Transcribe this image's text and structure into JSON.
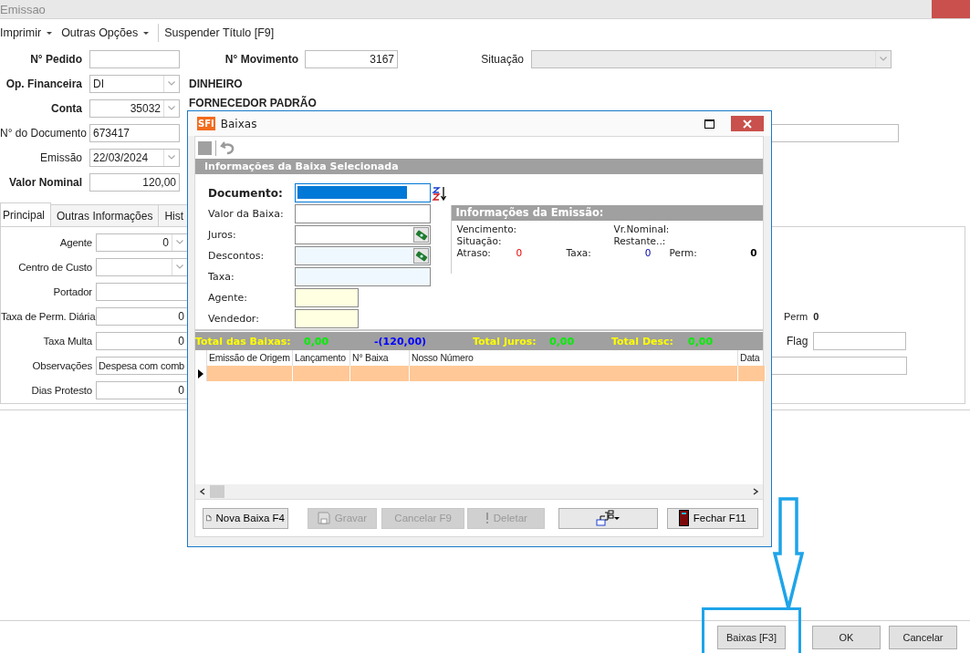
{
  "window": {
    "title": "Emissao"
  },
  "menu": [
    {
      "label": "Imprimir",
      "dropdown": true
    },
    {
      "label": "Outras Opções",
      "dropdown": true
    },
    {
      "label": "Suspender Título [F9]",
      "dropdown": false
    }
  ],
  "header": {
    "pedido": {
      "label": "N° Pedido"
    },
    "movimento": {
      "label": "N° Movimento",
      "value": "3167"
    },
    "situacao": {
      "label": "Situação",
      "disabled": true
    },
    "op_financeira": {
      "label": "Op. Financeira",
      "value": "DI",
      "description": "DINHEIRO"
    },
    "conta": {
      "label": "Conta",
      "value": "35032",
      "description": "FORNECEDOR PADRÃO"
    },
    "documento": {
      "label": "N° do Documento",
      "value": "673417"
    },
    "emissao": {
      "label": "Emissão",
      "value": "22/03/2024"
    },
    "valor_nominal": {
      "label": "Valor Nominal",
      "value": "120,00"
    }
  },
  "tabs": [
    {
      "label": "Principal",
      "selected": true
    },
    {
      "label": "Outras Informações",
      "selected": false
    },
    {
      "label": "Hist",
      "selected": false
    }
  ],
  "principal": {
    "fields": [
      {
        "label": "Agente",
        "value": "0",
        "kind": "combo"
      },
      {
        "label": "Centro de Custo",
        "kind": "combo"
      },
      {
        "label": "Portador",
        "kind": "number"
      },
      {
        "label": "Taxa de Perm. Diária",
        "value": "0",
        "kind": "number"
      },
      {
        "label": "Taxa Multa",
        "value": "0",
        "kind": "number"
      },
      {
        "label": "Observações",
        "value": "Despesa com comb",
        "kind": "text"
      },
      {
        "label": "Dias Protesto",
        "value": "0",
        "kind": "number"
      }
    ],
    "perm": {
      "label": "Perm",
      "value": "0"
    },
    "flag": {
      "label": "Flag"
    }
  },
  "footer_buttons": [
    {
      "label": "Baixas [F3]"
    },
    {
      "label": "OK"
    },
    {
      "label": "Cancelar"
    }
  ],
  "dialog": {
    "title": "Baixas",
    "logo": "SFI",
    "section_title": "Informações da Baixa Selecionada",
    "fields": [
      {
        "label": "Documento:",
        "kind": "document"
      },
      {
        "label": "Valor da Baixa:",
        "kind": "plain"
      },
      {
        "label": "Juros:",
        "kind": "money"
      },
      {
        "label": "Descontos:",
        "kind": "money_tinted"
      },
      {
        "label": "Taxa:",
        "kind": "tinted"
      },
      {
        "label": "Agente:",
        "kind": "lookup"
      },
      {
        "label": "Vendedor:",
        "kind": "lookup"
      }
    ],
    "emission_info": {
      "title": "Informações da Emissão:",
      "vencimento": "Vencimento:",
      "vr_nominal": "Vr.Nominal:",
      "situacao": "Situação:",
      "restante": "Restante..:",
      "atraso": {
        "label": "Atraso:",
        "value": "0"
      },
      "taxa": {
        "label": "Taxa:",
        "value": "0"
      },
      "perm": {
        "label": "Perm:",
        "value": "0"
      }
    },
    "totals": {
      "baixas": {
        "label": "Total das Baixas:",
        "value": "0,00"
      },
      "saldo": "-(120,00)",
      "juros": {
        "label": "Total Juros:",
        "value": "0,00"
      },
      "desc": {
        "label": "Total Desc:",
        "value": "0,00"
      }
    },
    "grid": {
      "columns": [
        "Emissão de Origem",
        "Lançamento",
        "N° Baixa",
        "Nosso Número",
        "Data"
      ],
      "rows": [
        {
          "current": true
        }
      ]
    },
    "buttons": [
      {
        "label": "Nova Baixa F4",
        "kind": "new",
        "disabled": false
      },
      {
        "label": "Gravar",
        "kind": "save",
        "disabled": true
      },
      {
        "label": "Cancelar F9",
        "kind": "cancel",
        "disabled": true
      },
      {
        "label": "Deletar",
        "kind": "delete",
        "disabled": true
      },
      {
        "kind": "tree",
        "disabled": false
      },
      {
        "label": "Fechar F11",
        "kind": "close",
        "disabled": false
      }
    ]
  }
}
